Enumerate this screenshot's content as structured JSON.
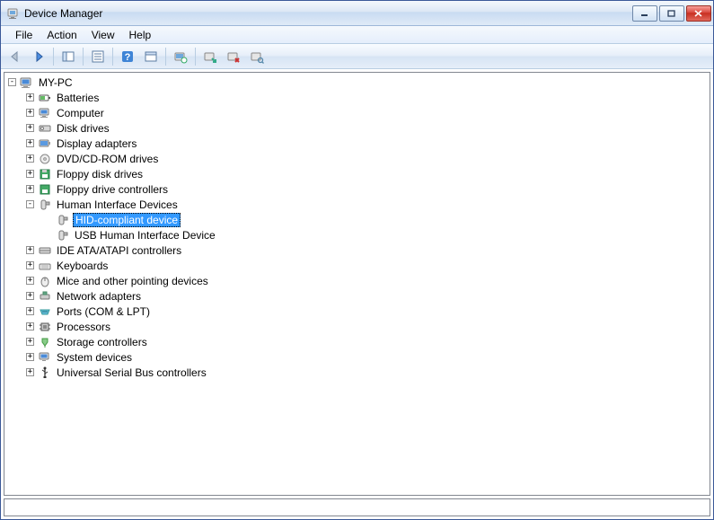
{
  "window": {
    "title": "Device Manager"
  },
  "menu": {
    "file": "File",
    "action": "Action",
    "view": "View",
    "help": "Help"
  },
  "tree": {
    "root": "MY-PC",
    "batteries": "Batteries",
    "computer": "Computer",
    "disk_drives": "Disk drives",
    "display_adapters": "Display adapters",
    "dvd_cd": "DVD/CD-ROM drives",
    "floppy_disk": "Floppy disk drives",
    "floppy_ctrl": "Floppy drive controllers",
    "hid": "Human Interface Devices",
    "hid_compliant": "HID-compliant device",
    "usb_hid": "USB Human Interface Device",
    "ide": "IDE ATA/ATAPI controllers",
    "keyboards": "Keyboards",
    "mice": "Mice and other pointing devices",
    "network": "Network adapters",
    "ports": "Ports (COM & LPT)",
    "processors": "Processors",
    "storage": "Storage controllers",
    "system": "System devices",
    "usb": "Universal Serial Bus controllers"
  }
}
